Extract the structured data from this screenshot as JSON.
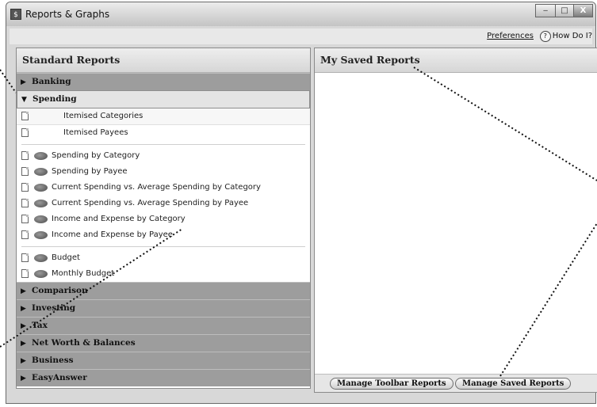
{
  "window": {
    "title": "Reports & Graphs",
    "app_icon_glyph": "$",
    "minimize": "‒",
    "maximize": "□",
    "close": "X"
  },
  "topbar": {
    "preferences_label": "Preferences",
    "help_label": "How Do I?",
    "help_glyph": "?"
  },
  "standard_reports": {
    "title": "Standard Reports",
    "groups": [
      {
        "label": "Banking",
        "expanded": false
      },
      {
        "label": "Spending",
        "expanded": true
      },
      {
        "label": "Comparison",
        "expanded": false
      },
      {
        "label": "Investing",
        "expanded": false
      },
      {
        "label": "Tax",
        "expanded": false
      },
      {
        "label": "Net Worth & Balances",
        "expanded": false
      },
      {
        "label": "Business",
        "expanded": false
      },
      {
        "label": "EasyAnswer",
        "expanded": false
      }
    ],
    "spending_items_a": [
      "Itemised Categories",
      "Itemised Payees"
    ],
    "spending_items_b": [
      "Spending by Category",
      "Spending by Payee",
      "Current Spending vs. Average Spending by Category",
      "Current Spending vs. Average Spending by Payee",
      "Income and Expense by Category",
      "Income and Expense by Payee"
    ],
    "spending_items_c": [
      "Budget",
      "Monthly Budget"
    ]
  },
  "saved_reports": {
    "title": "My Saved Reports",
    "manage_toolbar_label": "Manage Toolbar Reports",
    "manage_saved_label": "Manage Saved Reports"
  },
  "icons": {
    "expanded": "▼",
    "collapsed": "▶"
  }
}
